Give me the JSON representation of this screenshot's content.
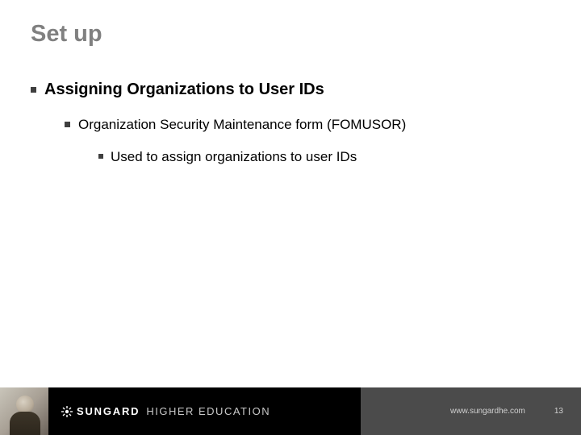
{
  "title": "Set up",
  "bullets": {
    "level1": "Assigning Organizations to User IDs",
    "level2": "Organization Security Maintenance form (FOMUSOR)",
    "level3": "Used to assign organizations to user IDs"
  },
  "footer": {
    "brand_main": "SUNGARD",
    "brand_sub": "HIGHER EDUCATION",
    "url": "www.sungardhe.com",
    "page": "13"
  }
}
